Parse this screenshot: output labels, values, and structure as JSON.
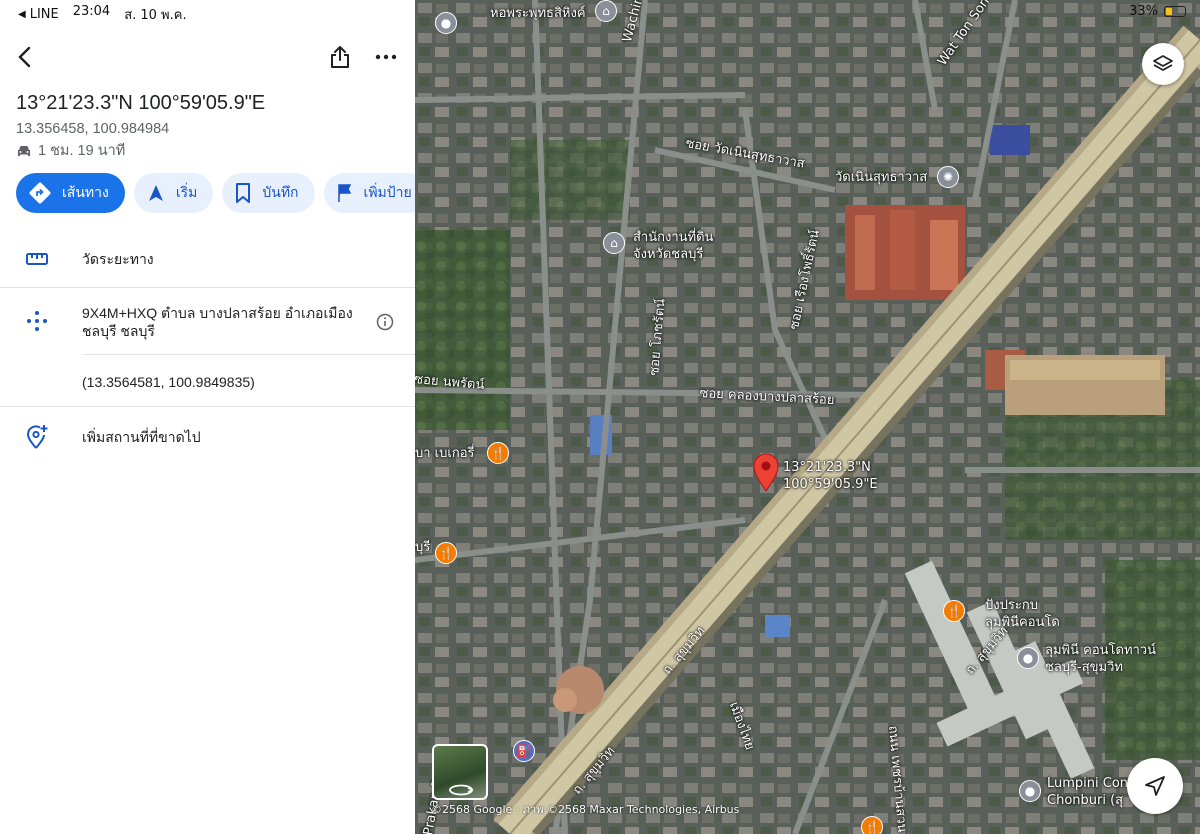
{
  "status_bar": {
    "back_app": "LINE",
    "time": "23:04",
    "date": "ส. 10 พ.ค.",
    "battery": "33%",
    "battery_level": 0.33
  },
  "place": {
    "dms": "13°21'23.3\"N 100°59'05.9\"E",
    "decimal": "13.356458, 100.984984",
    "drive_time": "1 ชม. 19 นาที"
  },
  "actions": [
    {
      "label": "เส้นทาง",
      "icon": "directions-icon"
    },
    {
      "label": "เริ่ม",
      "icon": "navigation-arrow-icon"
    },
    {
      "label": "บันทึก",
      "icon": "bookmark-icon"
    },
    {
      "label": "เพิ่มป้าย",
      "icon": "flag-icon"
    }
  ],
  "rows": {
    "measure": "วัดระยะทาง",
    "plus_code": "9X4M+HXQ ตำบล บางปลาสร้อย อำเภอเมือง ชลบุรี ชลบุรี",
    "coordinates": "(13.3564581, 100.9849835)",
    "add_missing": "เพิ่มสถานที่ที่ขาดไป"
  },
  "map": {
    "labels": {
      "wat_top": "หอพระพุทธสิหิงค์",
      "wachira": "Wachira Prakan",
      "wat_ton_son": "Wat Ton Son",
      "soi_nen": "ซอย วัดเนินสุทธาวาส",
      "wat_nen": "วัดเนินสุทธาวาส",
      "land_office_1": "สำนักงานที่ดิน",
      "land_office_2": "จังหวัดชลบุรี",
      "soi_rueang": "ซอย เรืองโพธิ์รัตน์",
      "soi_pho": "ซอย โภชรัตน์",
      "soi_klong": "ซอย คลองบางปลาสร้อย",
      "soi_noppha": "ซอย นพรัตน์",
      "bakery": "บา เบเกอรี่",
      "sukhumvit_1": "ถ. สุขุมวิท",
      "sukhumvit_2": "ถ. สุขุมวิท",
      "sukhumvit_3": "ถ. สุขุมวิท",
      "mueang_thai": "เมืองไทย",
      "pang_1": "ปังประกบ",
      "pang_2": "ลุมพินีคอนโด",
      "lumpini_th_1": "ลุมพินี คอนโดทาวน์",
      "lumpini_th_2": "ชลบุรี-สุขุมวิท",
      "lumpini_en_1": "Lumpini Con",
      "lumpini_en_2": "Chonburi (สุ",
      "pin_1": "13°21'23.3\"N",
      "pin_2": "100°59'05.9\"E",
      "prakan_rd": "Prakan Rd",
      "left_cut": "บุรี",
      "chai_rd": "ถนน เพชรบ้านสวน"
    },
    "attribution": "©2568 Google · ภาพ ©2568 Maxar Technologies, Airbus"
  }
}
